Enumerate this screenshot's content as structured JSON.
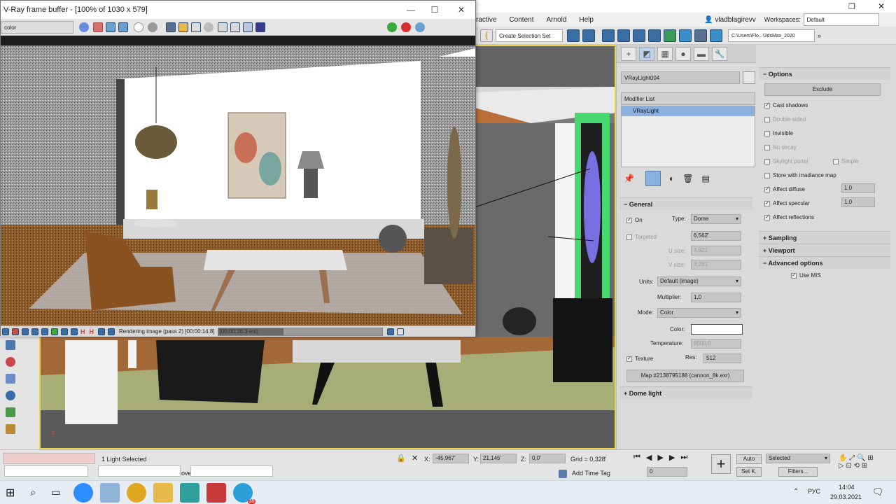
{
  "vfb": {
    "title": "V-Ray frame buffer - [100% of 1030 x 579]",
    "channel_select": "color",
    "status": "Rendering image (pass 2) [00:00:14,8]",
    "status_est": "[00:00:36,3 est]"
  },
  "menu": [
    "ractive",
    "Content",
    "Arnold",
    "Help"
  ],
  "user": "vladblagirevv",
  "workspaces_label": "Workspaces:",
  "workspace": "Default",
  "create_selection_set": "Create Selection Set",
  "project_path": "C:\\Users\\Flo...\\3dsMax_2020",
  "object_name": "VRayLight004",
  "modifier_list": "Modifier List",
  "modifier_item": "VRayLight",
  "general": {
    "header": "General",
    "on_label": "On",
    "type_label": "Type:",
    "type_value": "Dome",
    "targeted_label": "Targeted",
    "targeted_value": "6,562'",
    "usize_label": "U size:",
    "usize_value": "4,921'",
    "vsize_label": "V size:",
    "vsize_value": "3,281'",
    "units_label": "Units:",
    "units_value": "Default (image)",
    "multiplier_label": "Multiplier:",
    "multiplier_value": "1,0",
    "mode_label": "Mode:",
    "mode_value": "Color",
    "color_label": "Color:",
    "temperature_label": "Temperature:",
    "temperature_value": "6500,0",
    "texture_label": "Texture",
    "res_label": "Res:",
    "res_value": "512",
    "map_label": "Map #2138795188 (cannon_8k.exr)"
  },
  "dome_light": "Dome light",
  "options": {
    "header": "Options",
    "exclude": "Exclude",
    "cast_shadows": "Cast shadows",
    "double_sided": "Double-sided",
    "invisible": "Invisible",
    "no_decay": "No decay",
    "skylight_portal": "Skylight portal",
    "simple": "Simple",
    "store_irradiance": "Store with irradiance map",
    "affect_diffuse": "Affect diffuse",
    "affect_diffuse_value": "1,0",
    "affect_specular": "Affect specular",
    "affect_specular_value": "1,0",
    "affect_reflections": "Affect reflections"
  },
  "sampling": "Sampling",
  "viewport_roll": "Viewport",
  "advanced": "Advanced options",
  "use_mis": "Use MIS",
  "status": {
    "selection": "1 Light Selected",
    "x_label": "X:",
    "x_value": "-45,967'",
    "y_label": "Y:",
    "y_value": "21,145'",
    "z_label": "Z:",
    "z_value": "0,0'",
    "grid": "Grid = 0,328'",
    "add_time_tag": "Add Time Tag",
    "auto": "Auto",
    "setk": "Set K.",
    "selected": "Selected",
    "filters": "Filters...",
    "frame": "0",
    "move_label": "ove"
  },
  "taskbar": {
    "lang": "РУС",
    "time": "14:04",
    "date": "29.03.2021",
    "badge": "35"
  }
}
